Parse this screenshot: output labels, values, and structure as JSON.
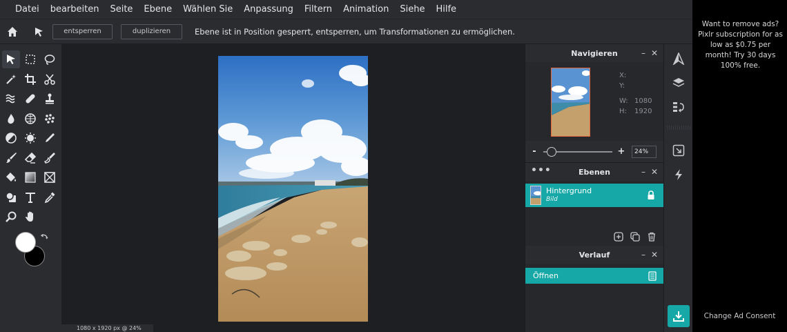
{
  "menu": [
    "Datei",
    "bearbeiten",
    "Seite",
    "Ebene",
    "Wählen Sie",
    "Anpassung",
    "Filtern",
    "Animation",
    "Siehe",
    "Hilfe"
  ],
  "optionbar": {
    "unlock_label": "entsperren",
    "duplicate_label": "duplizieren",
    "message": "Ebene ist in Position gesperrt, entsperren, um Transformationen zu ermöglichen."
  },
  "tools": [
    "select-tool",
    "marquee-tool",
    "lasso-tool",
    "magic-wand-tool",
    "crop-tool",
    "cut-tool",
    "liquify-tool",
    "healing-tool",
    "clone-stamp-tool",
    "blur-tool",
    "sponge-tool",
    "scatter-tool",
    "dodge-burn-tool",
    "sharpen-tool",
    "pen-tool",
    "brush-tool",
    "eraser-tool",
    "smudge-tool",
    "fill-tool",
    "gradient-tool",
    "placeholder-tool",
    "shape-tool",
    "text-tool",
    "eyedropper-tool",
    "zoom-tool",
    "hand-tool",
    ""
  ],
  "colors": {
    "foreground": "#ffffff",
    "background": "#000000",
    "accent": "#15a8a6"
  },
  "status": "1080 x 1920 px @ 24%",
  "navigator": {
    "title": "Navigieren",
    "x_label": "X:",
    "x_value": "",
    "y_label": "Y:",
    "y_value": "",
    "w_label": "W:",
    "w_value": "1080",
    "h_label": "H:",
    "h_value": "1920",
    "zoom_value": "24%",
    "zoom_fraction": 0.06
  },
  "layers": {
    "title": "Ebenen",
    "items": [
      {
        "name": "Hintergrund",
        "type": "Bild",
        "locked": true
      }
    ]
  },
  "history": {
    "title": "Verlauf",
    "items": [
      {
        "label": "Öffnen"
      }
    ]
  },
  "ad": {
    "text": "Want to remove ads? Pixlr subscription for as low as $0.75 per month! Try 30 days 100% free.",
    "consent": "Change Ad Consent"
  }
}
